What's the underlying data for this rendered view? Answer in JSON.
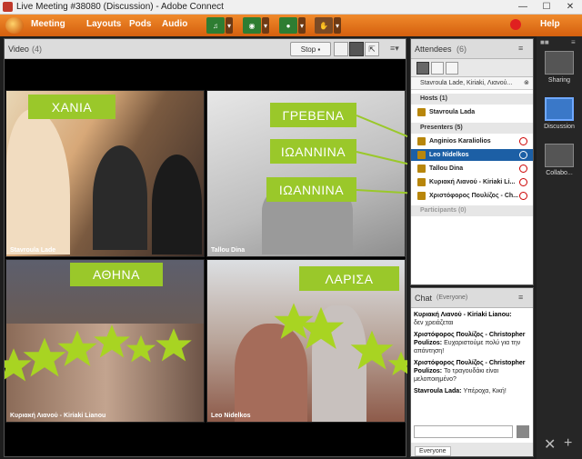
{
  "window": {
    "title": "Live Meeting #38080 (Discussion) - Adobe Connect",
    "controls": [
      "—",
      "☐",
      "✕"
    ]
  },
  "menubar": {
    "items": [
      "Meeting",
      "Layouts",
      "Pods",
      "Audio"
    ],
    "help": "Help"
  },
  "video_pod": {
    "title": "Video",
    "count": "(4)",
    "stop_label": "Stop",
    "tiles": [
      {
        "name": "Stavroula Lade",
        "place": "ΧΑΝΙΑ"
      },
      {
        "name": "Tallou Dina",
        "place": "ΓΡΕΒΕΝΑ"
      },
      {
        "name": "Κυριακή Λιανού - Kiriaki Lianou",
        "place": "ΑΘΗΝΑ"
      },
      {
        "name": "Leo Nidelkos",
        "place": "ΛΑΡΙΣΑ"
      }
    ],
    "extra_labels": [
      "ΙΩΑΝΝΙΝΑ",
      "ΙΩΑΝΝΙΝΑ"
    ],
    "accent": "#9ac82a"
  },
  "attendees": {
    "title": "Attendees",
    "count": "(6)",
    "search_text": "Stavroula Lade, Kiriaki, Λιανού...",
    "hosts_label": "Hosts (1)",
    "hosts": [
      "Stavroula Lada"
    ],
    "presenters_label": "Presenters (5)",
    "presenters": [
      "Anginios Karaliolios",
      "Leo Nidelkos",
      "Tallou Dina",
      "Κυριακή Λιανού - Kiriaki Li...",
      "Χριστόφορος Πουλίζος - Ch..."
    ],
    "participants_label": "Participants (0)"
  },
  "chat": {
    "title": "Chat",
    "scope": "(Everyone)",
    "messages": [
      {
        "from": "Κυριακή Λιανού - Kiriaki Lianou:",
        "text": "δεν χρειάζεται"
      },
      {
        "from": "Χριστόφορος Πουλίζος - Christopher Poulizos:",
        "text": "Ευχαριστούμε πολύ για την απάντηση!"
      },
      {
        "from": "Χριστόφορος Πουλίζος - Christopher Poulizos:",
        "text": "Το τραγουδάκι είναι μελοποιημένο?"
      },
      {
        "from": "Stavroula Lada:",
        "text": "Υπέροχα, Κική!"
      }
    ],
    "tab_label": "Everyone"
  },
  "layouts": {
    "items": [
      "Sharing",
      "Discussion",
      "Collabo..."
    ],
    "active": "Discussion"
  }
}
